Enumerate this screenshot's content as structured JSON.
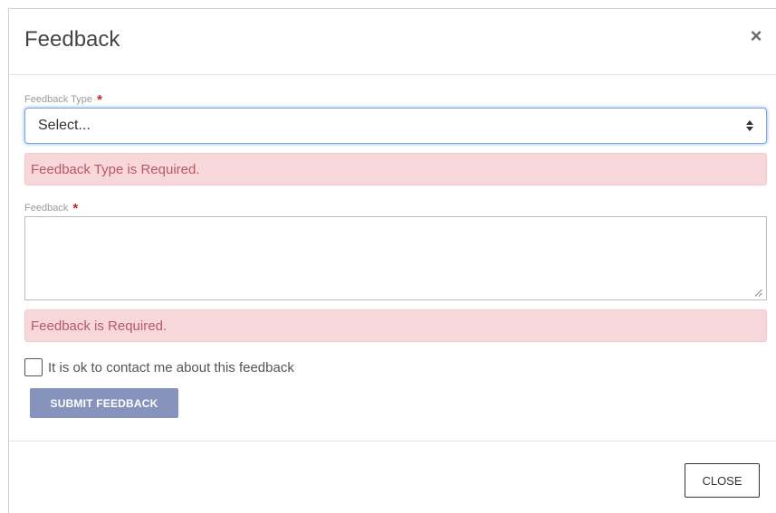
{
  "modal": {
    "title": "Feedback",
    "close_icon": "close-icon",
    "close_glyph": "×"
  },
  "form": {
    "feedback_type": {
      "label": "Feedback Type",
      "required_marker": "*",
      "selected_value": "Select...",
      "error": "Feedback Type is Required."
    },
    "feedback": {
      "label": "Feedback",
      "required_marker": "*",
      "value": "",
      "error": "Feedback is Required."
    },
    "contact_checkbox": {
      "label": "It is ok to contact me about this feedback",
      "checked": false
    },
    "submit_label": "SUBMIT FEEDBACK"
  },
  "footer": {
    "close_label": "CLOSE"
  },
  "colors": {
    "error_background": "#f8d7da",
    "error_text": "#b45a66",
    "required_star": "#c0262d",
    "submit_button": "#8593bd",
    "focus_border": "#7ea7d8"
  }
}
